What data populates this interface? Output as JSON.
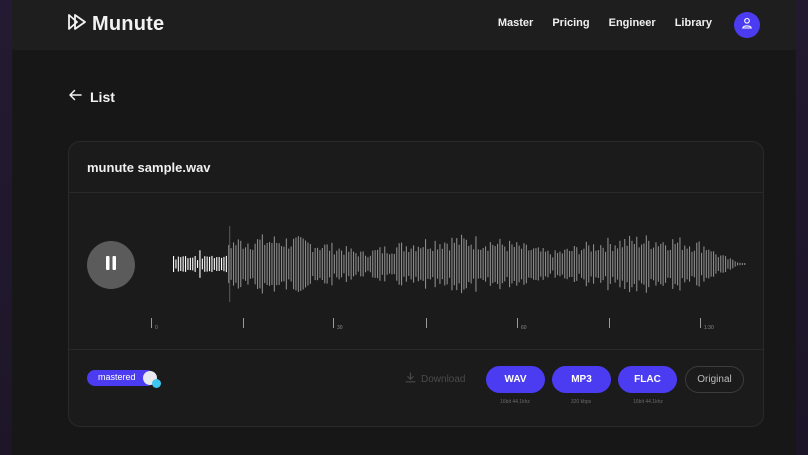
{
  "brand": {
    "name": "Munute",
    "logo_icon": "play-logo-icon"
  },
  "nav": {
    "items": [
      "Master",
      "Pricing",
      "Engineer",
      "Library"
    ],
    "avatar_icon": "user-icon"
  },
  "back": {
    "label": "List",
    "icon": "arrow-left-icon"
  },
  "track": {
    "filename": "munute sample.wav",
    "player_state": "playing",
    "progress": 0.1,
    "timeline_labels": [
      "0",
      "30",
      "60",
      "1:30"
    ]
  },
  "footer": {
    "mastered_label": "mastered",
    "mastered_on": true,
    "download_label": "Download",
    "formats": [
      {
        "label": "WAV",
        "sub": "16bit 44.1khz"
      },
      {
        "label": "MP3",
        "sub": "320 kbps"
      },
      {
        "label": "FLAC",
        "sub": "16bit 44.1khz"
      }
    ],
    "original_label": "Original"
  },
  "colors": {
    "accent": "#4b3cf2",
    "background": "#171717",
    "card": "#1b1b1b",
    "wave": "#8a8a8a",
    "wave_played": "#ffffff"
  }
}
